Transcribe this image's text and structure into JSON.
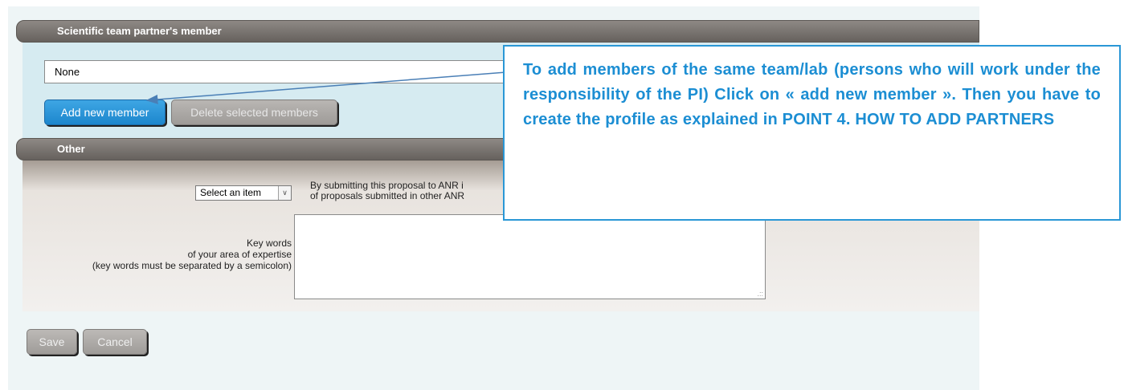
{
  "team_section": {
    "header": "Scientific team partner's member",
    "member_value": "None",
    "add_button": "Add new member",
    "delete_button": "Delete selected members"
  },
  "other_section": {
    "header": "Other",
    "select_value": "Select an item",
    "consent_line1": "By submitting this proposal to ANR i",
    "consent_line2": "of proposals submitted in other ANR",
    "keywords_line1": "Key words",
    "keywords_line2": "of your area of expertise",
    "keywords_line3": "(key words must be separated by a semicolon)"
  },
  "actions": {
    "save": "Save",
    "cancel": "Cancel"
  },
  "callout": {
    "text": "To add members of the same team/lab (persons who will work under the responsibility of the PI) Click on « add new member ». Then you have to create the profile as explained in POINT 4. HOW TO ADD PARTNERS"
  },
  "colors": {
    "callout_accent": "#1c8ed3",
    "primary_button": "#1c86cd",
    "header_gray": "#66615d"
  },
  "icons": {
    "select_arrow": "chevron-down-icon",
    "resize": "resize-grip-icon"
  }
}
